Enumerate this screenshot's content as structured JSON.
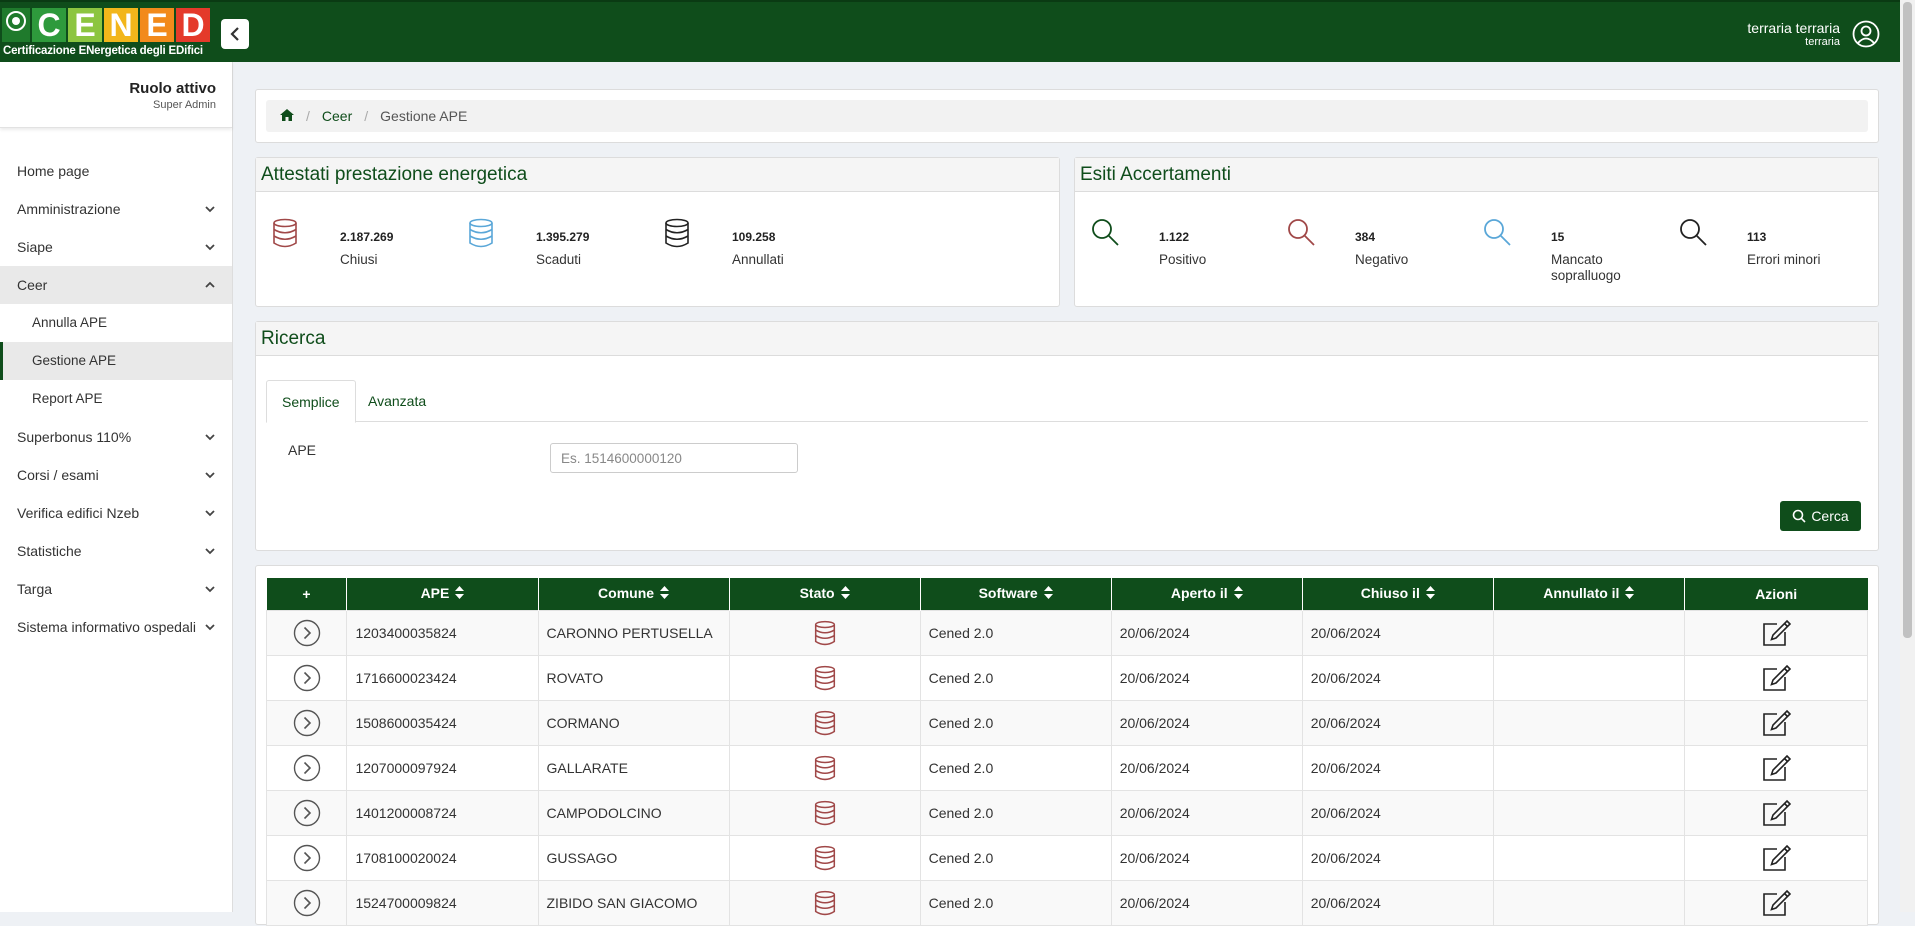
{
  "header": {
    "logo_letters": [
      "C",
      "E",
      "N",
      "E",
      "D"
    ],
    "logo_letter_colors": [
      "#2e9a3c",
      "#8cc540",
      "#f2b61b",
      "#f28a1b",
      "#e43a2a"
    ],
    "logo_subtitle": "Certificazione ENergetica degli EDifici",
    "user_name": "terraria terraria",
    "user_sub": "terraria"
  },
  "sidebar": {
    "role_title": "Ruolo attivo",
    "role_sub": "Super Admin",
    "items": [
      {
        "label": "Home page"
      },
      {
        "label": "Amministrazione"
      },
      {
        "label": "Siape"
      },
      {
        "label": "Ceer"
      },
      {
        "label": "Annulla APE"
      },
      {
        "label": "Gestione APE"
      },
      {
        "label": "Report APE"
      },
      {
        "label": "Superbonus 110%"
      },
      {
        "label": "Corsi / esami"
      },
      {
        "label": "Verifica edifici Nzeb"
      },
      {
        "label": "Statistiche"
      },
      {
        "label": "Targa"
      },
      {
        "label": "Sistema informativo ospedali"
      }
    ]
  },
  "breadcrumb": {
    "home_icon": "home-icon",
    "items": [
      "Ceer",
      "Gestione APE"
    ]
  },
  "attestati": {
    "title": "Attestati prestazione energetica",
    "stats": [
      {
        "value": "2.187.269",
        "label": "Chiusi",
        "color": "#a04848"
      },
      {
        "value": "1.395.279",
        "label": "Scaduti",
        "color": "#5aa7d8"
      },
      {
        "value": "109.258",
        "label": "Annullati",
        "color": "#222222"
      }
    ]
  },
  "esiti": {
    "title": "Esiti Accertamenti",
    "stats": [
      {
        "value": "1.122",
        "label": "Positivo",
        "color": "#0f4d1b"
      },
      {
        "value": "384",
        "label": "Negativo",
        "color": "#a04848"
      },
      {
        "value": "15",
        "label": "Mancato sopralluogo",
        "color": "#5aa7d8"
      },
      {
        "value": "113",
        "label": "Errori minori",
        "color": "#222222"
      }
    ]
  },
  "ricerca": {
    "title": "Ricerca",
    "tabs": [
      "Semplice",
      "Avanzata"
    ],
    "field_label": "APE",
    "field_placeholder": "Es. 1514600000120",
    "button_label": "Cerca"
  },
  "table": {
    "columns": [
      "+",
      "APE",
      "Comune",
      "Stato",
      "Software",
      "Aperto il",
      "Chiuso il",
      "Annullato il",
      "Azioni"
    ],
    "rows": [
      {
        "ape": "1203400035824",
        "comune": "CARONNO PERTUSELLA",
        "software": "Cened 2.0",
        "aperto": "20/06/2024",
        "chiuso": "20/06/2024",
        "annullato": ""
      },
      {
        "ape": "1716600023424",
        "comune": "ROVATO",
        "software": "Cened 2.0",
        "aperto": "20/06/2024",
        "chiuso": "20/06/2024",
        "annullato": ""
      },
      {
        "ape": "1508600035424",
        "comune": "CORMANO",
        "software": "Cened 2.0",
        "aperto": "20/06/2024",
        "chiuso": "20/06/2024",
        "annullato": ""
      },
      {
        "ape": "1207000097924",
        "comune": "GALLARATE",
        "software": "Cened 2.0",
        "aperto": "20/06/2024",
        "chiuso": "20/06/2024",
        "annullato": ""
      },
      {
        "ape": "1401200008724",
        "comune": "CAMPODOLCINO",
        "software": "Cened 2.0",
        "aperto": "20/06/2024",
        "chiuso": "20/06/2024",
        "annullato": ""
      },
      {
        "ape": "1708100020024",
        "comune": "GUSSAGO",
        "software": "Cened 2.0",
        "aperto": "20/06/2024",
        "chiuso": "20/06/2024",
        "annullato": ""
      },
      {
        "ape": "1524700009824",
        "comune": "ZIBIDO SAN GIACOMO",
        "software": "Cened 2.0",
        "aperto": "20/06/2024",
        "chiuso": "20/06/2024",
        "annullato": ""
      }
    ]
  }
}
